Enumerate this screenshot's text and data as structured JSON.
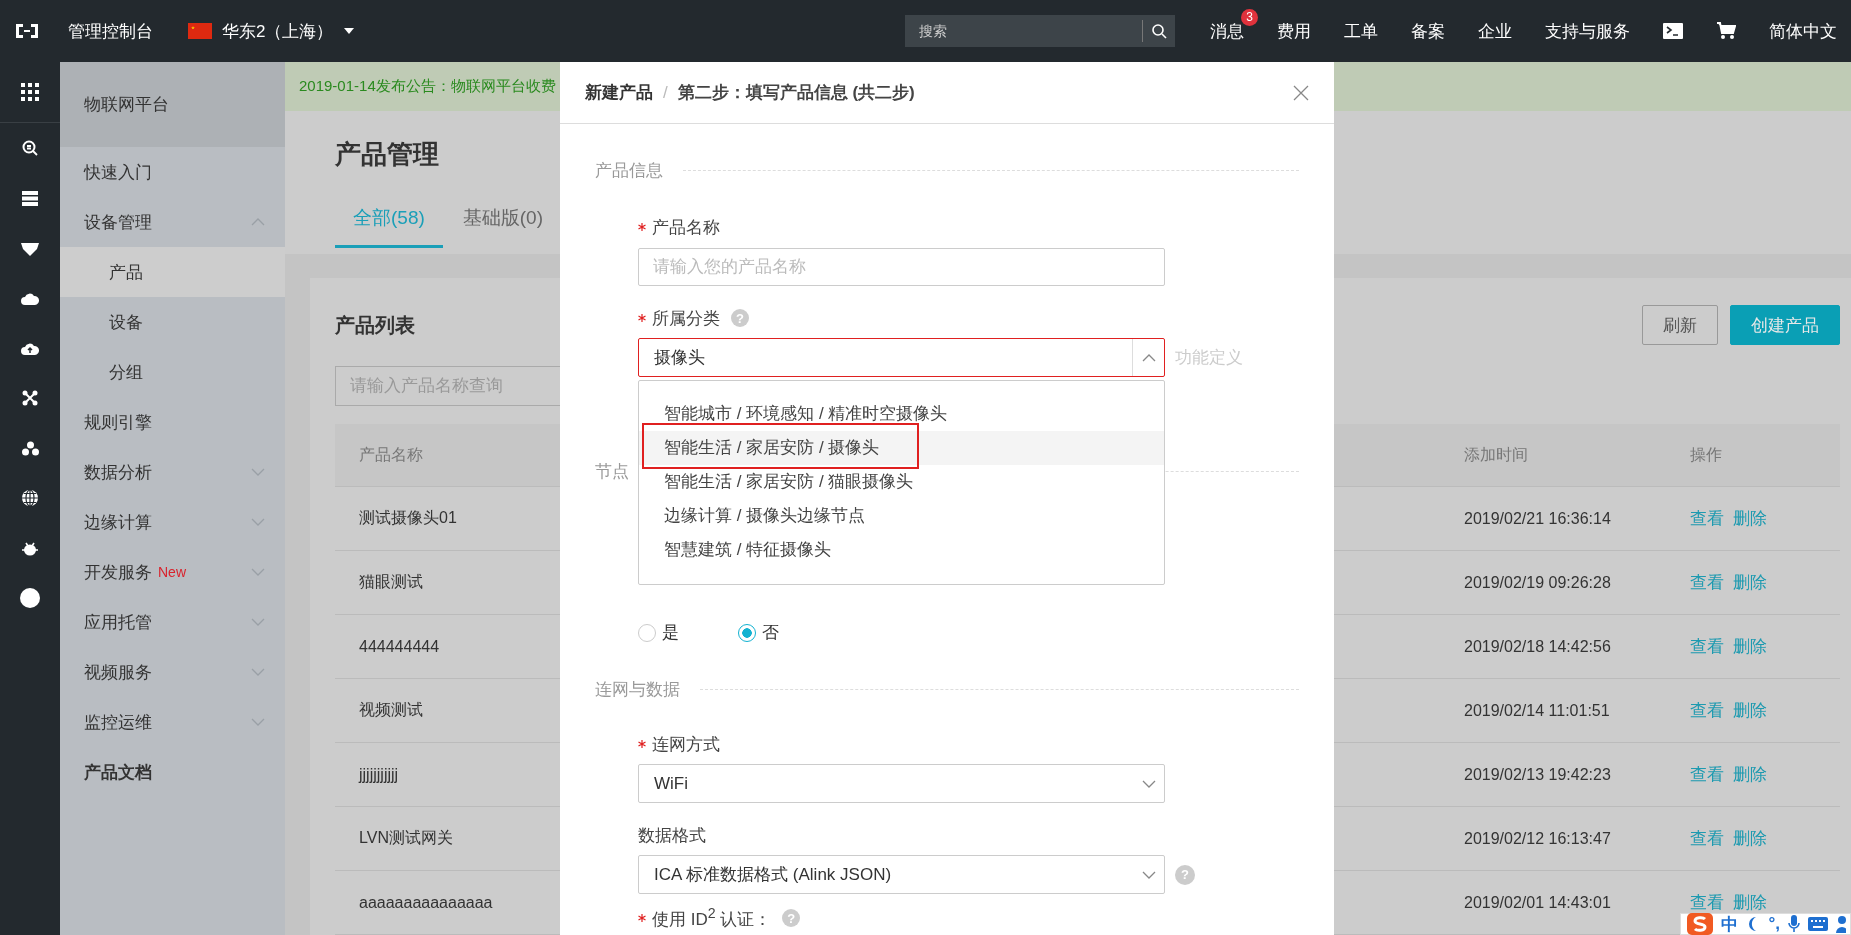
{
  "top_bar": {
    "console_label": "管理控制台",
    "region": "华东2（上海）",
    "search": {
      "placeholder": "搜索"
    },
    "nav": [
      {
        "kind": "text",
        "label": "消息",
        "badge": "3"
      },
      {
        "kind": "text",
        "label": "费用"
      },
      {
        "kind": "text",
        "label": "工单"
      },
      {
        "kind": "text",
        "label": "备案"
      },
      {
        "kind": "text",
        "label": "企业"
      },
      {
        "kind": "text",
        "label": "支持与服务"
      },
      {
        "kind": "terminal"
      },
      {
        "kind": "cart"
      },
      {
        "kind": "text",
        "label": "简体中文"
      }
    ]
  },
  "icon_rail": [
    {
      "kind": "grid"
    },
    {
      "kind": "search"
    },
    {
      "kind": "server"
    },
    {
      "kind": "shield"
    },
    {
      "kind": "cloud"
    },
    {
      "kind": "cloud-up"
    },
    {
      "kind": "cross"
    },
    {
      "kind": "cluster"
    },
    {
      "kind": "globe"
    },
    {
      "kind": "bug"
    },
    {
      "kind": "circle"
    }
  ],
  "sidebar": {
    "title": "物联网平台",
    "items": [
      {
        "kind": "plain",
        "label": "快速入门",
        "selected": false
      },
      {
        "kind": "group",
        "label": "设备管理",
        "selected": false,
        "expanded": true,
        "children": [
          {
            "label": "产品",
            "selected": true
          },
          {
            "label": "设备",
            "selected": false
          },
          {
            "label": "分组",
            "selected": false
          }
        ]
      },
      {
        "kind": "plain",
        "label": "规则引擎",
        "selected": false
      },
      {
        "kind": "group",
        "label": "数据分析",
        "selected": false,
        "expanded": false
      },
      {
        "kind": "group",
        "label": "边缘计算",
        "selected": false,
        "expanded": false
      },
      {
        "kind": "group",
        "label": "开发服务",
        "badge": "New",
        "selected": false,
        "expanded": false
      },
      {
        "kind": "group",
        "label": "应用托管",
        "selected": false,
        "expanded": false
      },
      {
        "kind": "group",
        "label": "视频服务",
        "selected": false,
        "expanded": false
      },
      {
        "kind": "group",
        "label": "监控运维",
        "selected": false,
        "expanded": false
      },
      {
        "kind": "doc",
        "label": "产品文档",
        "selected": false
      }
    ]
  },
  "notice": "2019-01-14发布公告：物联网平台收费",
  "page_title": "产品管理",
  "tabs": [
    {
      "label": "全部(58)",
      "selected": true
    },
    {
      "label": "基础版(0)",
      "selected": false
    }
  ],
  "product_list": {
    "title": "产品列表",
    "search": {
      "placeholder": "请输入产品名称查询"
    },
    "buttons": [
      {
        "kind": "secondary",
        "label": "刷新"
      },
      {
        "kind": "primary",
        "label": "创建产品"
      }
    ],
    "columns": [
      "产品名称",
      "添加时间",
      "操作"
    ],
    "rows": [
      {
        "name": "测试摄像头01",
        "added": "2019/02/21 16:36:14",
        "actions": [
          "查看",
          "删除"
        ]
      },
      {
        "name": "猫眼测试",
        "added": "2019/02/19 09:26:28",
        "actions": [
          "查看",
          "删除"
        ]
      },
      {
        "name": "444444444",
        "added": "2019/02/18 14:42:56",
        "actions": [
          "查看",
          "删除"
        ]
      },
      {
        "name": "视频测试",
        "added": "2019/02/14 11:01:51",
        "actions": [
          "查看",
          "删除"
        ]
      },
      {
        "name": "jjjjjjjjjjj",
        "added": "2019/02/13 19:42:23",
        "actions": [
          "查看",
          "删除"
        ]
      },
      {
        "name": "LVN测试网关",
        "added": "2019/02/12 16:13:47",
        "actions": [
          "查看",
          "删除"
        ]
      },
      {
        "name": "aaaaaaaaaaaaaaa",
        "added": "2019/02/01 14:43:01",
        "actions": [
          "查看",
          "删除"
        ]
      }
    ]
  },
  "modal": {
    "breadcrumb": [
      "新建产品",
      "第二步：填写产品信息 (共二步)"
    ],
    "breadcrumb_separator": "/",
    "product_info": {
      "title": "产品信息",
      "name_field": {
        "label": "产品名称",
        "required": true,
        "placeholder": "请输入您的产品名称"
      },
      "category_field": {
        "label": "所属分类",
        "required": true,
        "help": "?",
        "value": "摄像头",
        "expanded": true,
        "options": [
          {
            "label": "智能城市 / 环境感知 / 精准时空摄像头",
            "selected": false,
            "annotated": false
          },
          {
            "label": "智能生活 / 家居安防 / 摄像头",
            "selected": true,
            "annotated": true
          },
          {
            "label": "智能生活 / 家居安防 / 猫眼摄像头",
            "selected": false,
            "annotated": false
          },
          {
            "label": "边缘计算 / 摄像头边缘节点",
            "selected": false,
            "annotated": false
          },
          {
            "label": "智慧建筑 / 特征摄像头",
            "selected": false,
            "annotated": false
          }
        ]
      },
      "side_text": "功能定义"
    },
    "node_section_title": "节点",
    "gateway_radios": [
      {
        "label": "是",
        "selected": false
      },
      {
        "label": "否",
        "selected": true
      }
    ],
    "network": {
      "title": "连网与数据",
      "fields": [
        {
          "label": "连网方式",
          "required": true,
          "value": "WiFi"
        },
        {
          "label": "数据格式",
          "required": false,
          "help": "?",
          "value": "ICA 标准数据格式 (Alink JSON)"
        }
      ],
      "id2": {
        "label": "使用 ID$^{2}$ 认证：",
        "required": true,
        "help": "?"
      }
    }
  },
  "ime_bar": {
    "mode": "中",
    "punctuation": "°,"
  }
}
